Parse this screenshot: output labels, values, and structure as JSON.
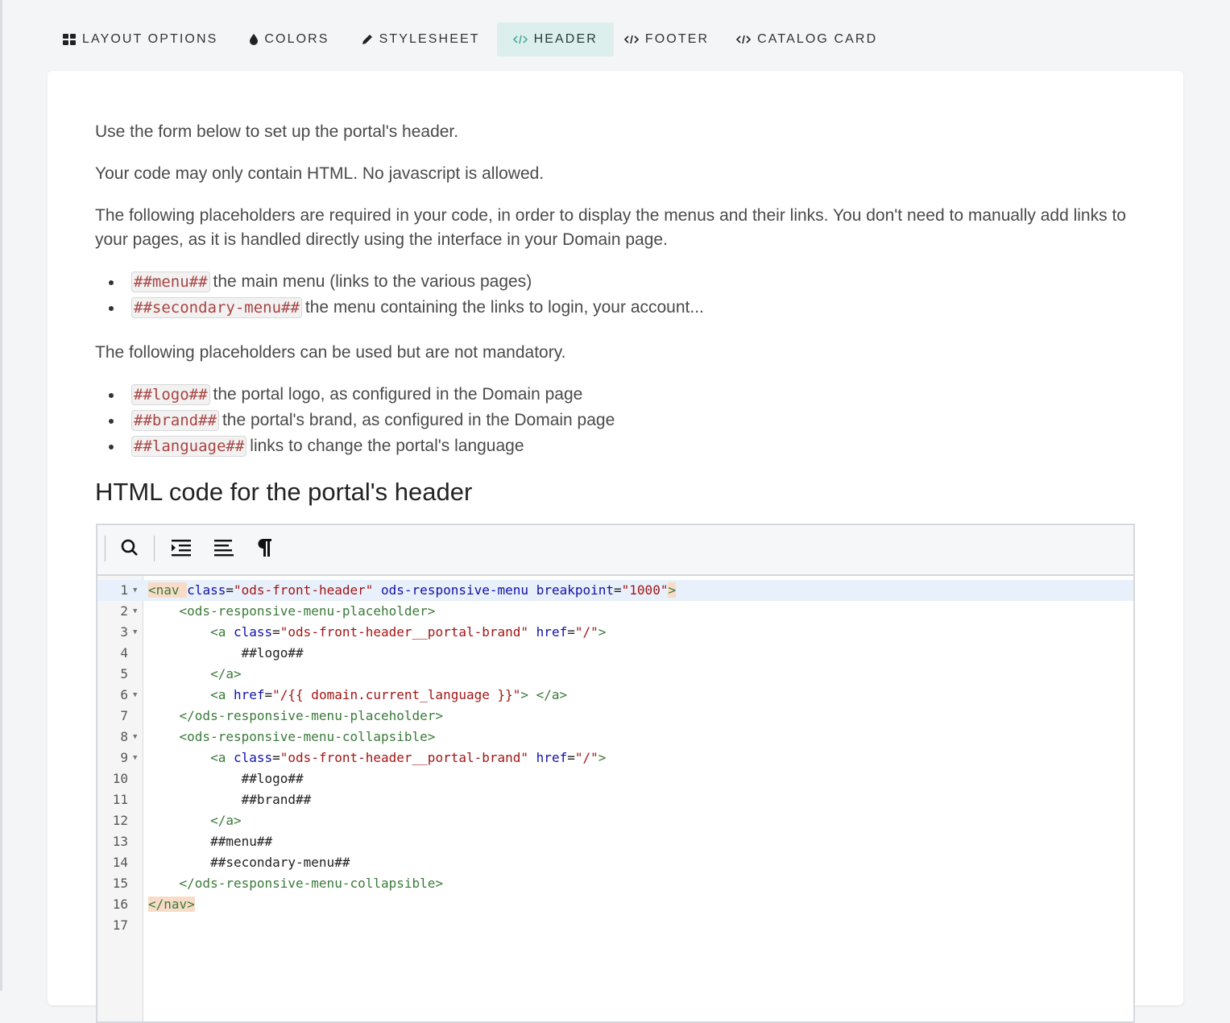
{
  "tabs": [
    {
      "label": "LAYOUT OPTIONS",
      "icon": "grid-icon"
    },
    {
      "label": "COLORS",
      "icon": "drop-icon"
    },
    {
      "label": "STYLESHEET",
      "icon": "pencil-icon"
    },
    {
      "label": "HEADER",
      "icon": "code-icon",
      "active": true
    },
    {
      "label": "FOOTER",
      "icon": "code-icon"
    },
    {
      "label": "CATALOG CARD",
      "icon": "code-icon"
    }
  ],
  "intro": {
    "p1": "Use the form below to set up the portal's header.",
    "p2": "Your code may only contain HTML. No javascript is allowed.",
    "p3": "The following placeholders are required in your code, in order to display the menus and their links. You don't need to manually add links to your pages, as it is handled directly using the interface in your Domain page.",
    "required": [
      {
        "tag": "##menu##",
        "desc": "the main menu (links to the various pages)"
      },
      {
        "tag": "##secondary-menu##",
        "desc": "the menu containing the links to login, your account..."
      }
    ],
    "p4": "The following placeholders can be used but are not mandatory.",
    "optional": [
      {
        "tag": "##logo##",
        "desc": "the portal logo, as configured in the Domain page"
      },
      {
        "tag": "##brand##",
        "desc": "the portal's brand, as configured in the Domain page"
      },
      {
        "tag": "##language##",
        "desc": "links to change the portal's language"
      }
    ]
  },
  "editor": {
    "title": "HTML code for the portal's header",
    "toolbar": [
      "search-icon",
      "indent-icon",
      "format-icon",
      "paragraph-icon"
    ],
    "lines": [
      {
        "n": "1",
        "fold": true,
        "tokens": [
          [
            "tag",
            "<nav "
          ],
          [
            "attr",
            "class"
          ],
          [
            "txt",
            "="
          ],
          [
            "str",
            "\"ods-front-header\""
          ],
          [
            "txt",
            " "
          ],
          [
            "attr",
            "ods-responsive-menu"
          ],
          [
            "txt",
            " "
          ],
          [
            "attr",
            "breakpoint"
          ],
          [
            "txt",
            "="
          ],
          [
            "str",
            "\"1000\""
          ],
          [
            "tag",
            ">"
          ]
        ],
        "hl": true
      },
      {
        "n": "2",
        "fold": true,
        "tokens": [
          [
            "txt",
            "    "
          ],
          [
            "tag",
            "<ods-responsive-menu-placeholder>"
          ]
        ]
      },
      {
        "n": "3",
        "fold": true,
        "tokens": [
          [
            "txt",
            "        "
          ],
          [
            "tag",
            "<a "
          ],
          [
            "attr",
            "class"
          ],
          [
            "txt",
            "="
          ],
          [
            "str",
            "\"ods-front-header__portal-brand\""
          ],
          [
            "txt",
            " "
          ],
          [
            "attr",
            "href"
          ],
          [
            "txt",
            "="
          ],
          [
            "str",
            "\"/\""
          ],
          [
            "tag",
            ">"
          ]
        ]
      },
      {
        "n": "4",
        "fold": false,
        "tokens": [
          [
            "txt",
            "            ##logo##"
          ]
        ]
      },
      {
        "n": "5",
        "fold": false,
        "tokens": [
          [
            "txt",
            "        "
          ],
          [
            "tag",
            "</a>"
          ]
        ]
      },
      {
        "n": "6",
        "fold": true,
        "tokens": [
          [
            "txt",
            "        "
          ],
          [
            "tag",
            "<a "
          ],
          [
            "attr",
            "href"
          ],
          [
            "txt",
            "="
          ],
          [
            "str",
            "\"/{{ domain.current_language }}\""
          ],
          [
            "tag",
            "> </a>"
          ]
        ]
      },
      {
        "n": "7",
        "fold": false,
        "tokens": [
          [
            "txt",
            "    "
          ],
          [
            "tag",
            "</ods-responsive-menu-placeholder>"
          ]
        ]
      },
      {
        "n": "8",
        "fold": true,
        "tokens": [
          [
            "txt",
            "    "
          ],
          [
            "tag",
            "<ods-responsive-menu-collapsible>"
          ]
        ]
      },
      {
        "n": "9",
        "fold": true,
        "tokens": [
          [
            "txt",
            "        "
          ],
          [
            "tag",
            "<a "
          ],
          [
            "attr",
            "class"
          ],
          [
            "txt",
            "="
          ],
          [
            "str",
            "\"ods-front-header__portal-brand\""
          ],
          [
            "txt",
            " "
          ],
          [
            "attr",
            "href"
          ],
          [
            "txt",
            "="
          ],
          [
            "str",
            "\"/\""
          ],
          [
            "tag",
            ">"
          ]
        ]
      },
      {
        "n": "10",
        "fold": false,
        "tokens": [
          [
            "txt",
            "            ##logo##"
          ]
        ]
      },
      {
        "n": "11",
        "fold": false,
        "tokens": [
          [
            "txt",
            "            ##brand##"
          ]
        ]
      },
      {
        "n": "12",
        "fold": false,
        "tokens": [
          [
            "txt",
            "        "
          ],
          [
            "tag",
            "</a>"
          ]
        ]
      },
      {
        "n": "13",
        "fold": false,
        "tokens": [
          [
            "txt",
            "        ##menu##"
          ]
        ]
      },
      {
        "n": "14",
        "fold": false,
        "tokens": [
          [
            "txt",
            "        ##secondary-menu##"
          ]
        ]
      },
      {
        "n": "15",
        "fold": false,
        "tokens": [
          [
            "txt",
            "    "
          ],
          [
            "tag",
            "</ods-responsive-menu-collapsible>"
          ]
        ]
      },
      {
        "n": "16",
        "fold": false,
        "tokens": [
          [
            "tag",
            "</nav>"
          ]
        ],
        "endhl": true
      },
      {
        "n": "17",
        "fold": false,
        "tokens": []
      }
    ]
  },
  "colors": {
    "active_tab_bg": "#dcefec",
    "active_tab_icon": "#4fa99a",
    "placeholder_text": "#a94442"
  }
}
